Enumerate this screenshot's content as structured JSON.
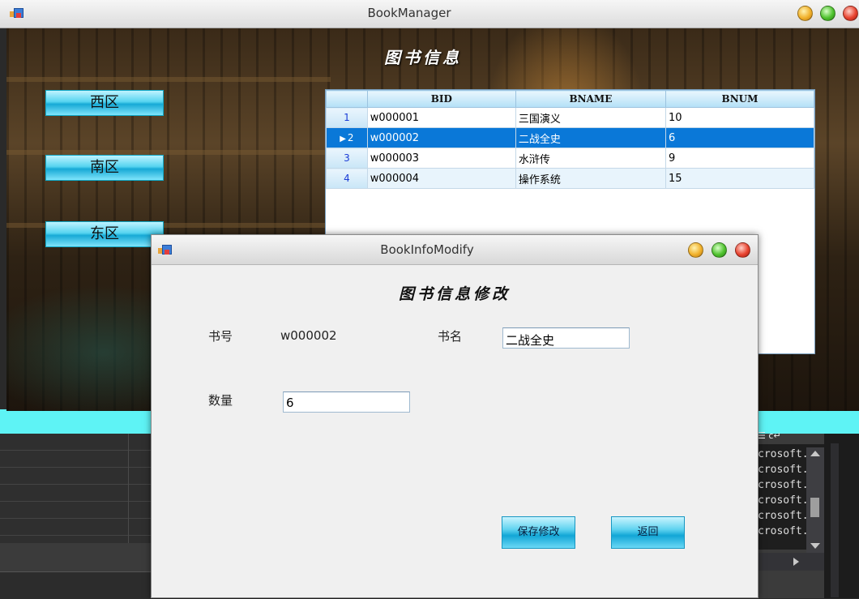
{
  "main_window": {
    "title": "BookManager",
    "banner": "图书信息",
    "zones": [
      "西区",
      "南区",
      "东区"
    ],
    "grid": {
      "columns": [
        "BID",
        "BNAME",
        "BNUM"
      ],
      "rows": [
        {
          "num": "1",
          "bid": "w000001",
          "bname": "三国演义",
          "bnum": "10"
        },
        {
          "num": "2",
          "bid": "w000002",
          "bname": "二战全史",
          "bnum": "6"
        },
        {
          "num": "3",
          "bid": "w000003",
          "bname": "水浒传",
          "bnum": "9"
        },
        {
          "num": "4",
          "bid": "w000004",
          "bname": "操作系统",
          "bnum": "15"
        }
      ],
      "selected_row": "2"
    }
  },
  "dialog": {
    "title": "BookInfoModify",
    "heading": "图书信息修改",
    "book_id_label": "书号",
    "book_id_value": "w000002",
    "book_name_label": "书名",
    "book_name_value": "二战全史",
    "quantity_label": "数量",
    "quantity_value": "6",
    "save_button": "保存修改",
    "back_button": "返回"
  },
  "background_ide": {
    "output_lines": [
      "crosoft.",
      "crosoft.",
      "crosoft.",
      "crosoft.",
      "crosoft.",
      "crosoft."
    ],
    "toolbar_glyph": "☰  c↵"
  },
  "colors": {
    "selection": "#0a78d8",
    "button_cyan": "#16a9d6",
    "row_header_text": "#1a3bd6"
  }
}
